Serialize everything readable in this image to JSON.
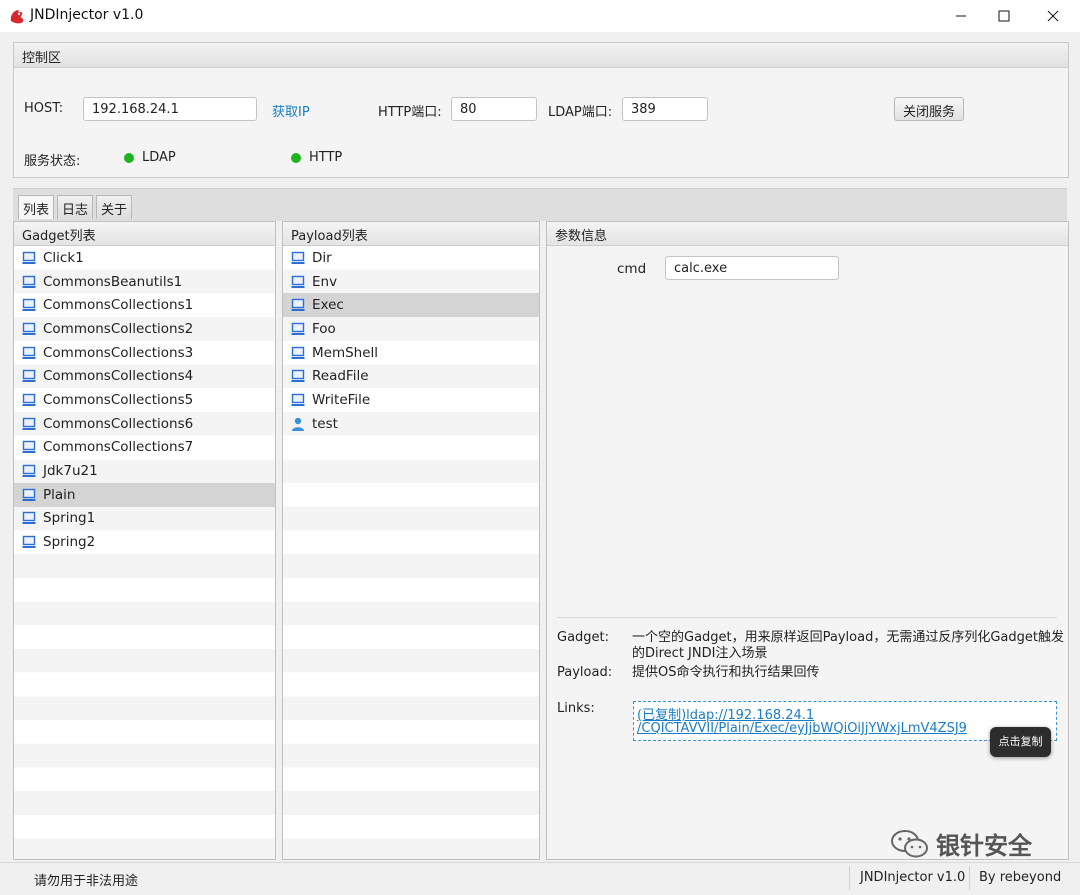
{
  "window": {
    "title": "JNDInjector v1.0",
    "min_icon": "minimize-icon",
    "max_icon": "maximize-icon",
    "close_icon": "close-icon"
  },
  "control": {
    "title": "控制区",
    "host_label": "HOST:",
    "host_value": "192.168.24.1",
    "get_ip_link": "获取IP",
    "http_port_label": "HTTP端口:",
    "http_port_value": "80",
    "ldap_port_label": "LDAP端口:",
    "ldap_port_value": "389",
    "stop_button": "关闭服务",
    "status_label": "服务状态:",
    "ldap_status": "LDAP",
    "http_status": "HTTP",
    "status_color": "#1db51d"
  },
  "tabs": [
    {
      "label": "列表"
    },
    {
      "label": "日志"
    },
    {
      "label": "关于"
    }
  ],
  "gadget_panel": {
    "header": "Gadget列表",
    "items": [
      "Click1",
      "CommonsBeanutils1",
      "CommonsCollections1",
      "CommonsCollections2",
      "CommonsCollections3",
      "CommonsCollections4",
      "CommonsCollections5",
      "CommonsCollections6",
      "CommonsCollections7",
      "Jdk7u21",
      "Plain",
      "Spring1",
      "Spring2"
    ],
    "selected": "Plain"
  },
  "payload_panel": {
    "header": "Payload列表",
    "items": [
      {
        "label": "Dir",
        "icon": "computer-icon"
      },
      {
        "label": "Env",
        "icon": "computer-icon"
      },
      {
        "label": "Exec",
        "icon": "computer-icon"
      },
      {
        "label": "Foo",
        "icon": "computer-icon"
      },
      {
        "label": "MemShell",
        "icon": "computer-icon"
      },
      {
        "label": "ReadFile",
        "icon": "computer-icon"
      },
      {
        "label": "WriteFile",
        "icon": "computer-icon"
      },
      {
        "label": "test",
        "icon": "user-icon"
      }
    ],
    "selected": "Exec"
  },
  "param_panel": {
    "header": "参数信息",
    "cmd_label": "cmd",
    "cmd_value": "calc.exe",
    "gadget_label": "Gadget:",
    "gadget_desc_1": "一个空的Gadget，用来原样返回Payload，无需通过反序列化Gadget触发",
    "gadget_desc_2": "的Direct JNDI注入场景",
    "payload_label": "Payload:",
    "payload_desc": "提供OS命令执行和执行结果回传",
    "links_label": "Links:",
    "link_line_1": "(已复制)ldap://192.168.24.1",
    "link_line_2": "/CQICTAVVII/Plain/Exec/eyJjbWQiOiJjYWxjLmV4ZSJ9",
    "tooltip": "点击复制"
  },
  "watermark": "银针安全",
  "statusbar": {
    "warning": "请勿用于非法用途",
    "version": "JNDInjector v1.0",
    "author": "By rebeyond"
  },
  "colors": {
    "icon_blue": "#2b6fd6",
    "link_blue": "#1a7cc8",
    "selection": "#d4d4d4"
  }
}
